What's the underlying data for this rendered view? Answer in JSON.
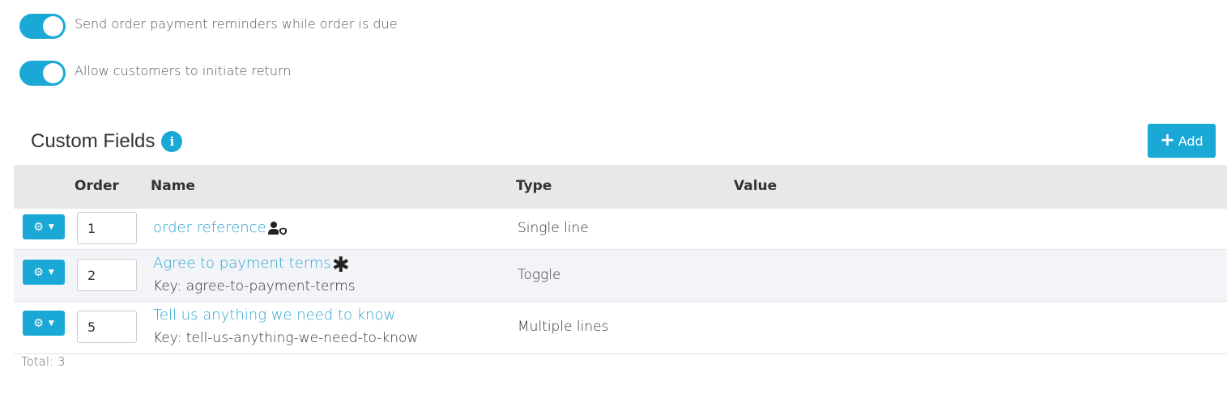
{
  "settings": {
    "payment_reminders": {
      "label": "Send order payment reminders while order is due",
      "enabled": true
    },
    "allow_returns": {
      "label": "Allow customers to initiate return",
      "enabled": true
    }
  },
  "custom_fields": {
    "title": "Custom Fields",
    "info_icon": "i",
    "add_button": {
      "icon": "+",
      "label": "Add"
    },
    "columns": [
      "Order",
      "Name",
      "Type",
      "Value"
    ],
    "rows": [
      {
        "order": "1",
        "name": "order reference",
        "key": "",
        "type": "Single line",
        "value": "",
        "badge_icon": "user-shield-icon"
      },
      {
        "order": "2",
        "name": "Agree to payment terms",
        "key": "Key: agree-to-payment-terms",
        "type": "Toggle",
        "value": "",
        "badge_icon": "required-asterisk-icon",
        "badge": "✱"
      },
      {
        "order": "5",
        "name": "Tell us anything we need to know",
        "key": "Key: tell-us-anything-we-need-to-know",
        "type": "Multiple lines",
        "value": ""
      }
    ],
    "total": "Total: 3"
  },
  "colors": {
    "accent": "#1aa9d6",
    "link": "#2aa4cf",
    "header_bg": "#e8e8e8",
    "alt_row_bg": "#f3f4f8"
  }
}
